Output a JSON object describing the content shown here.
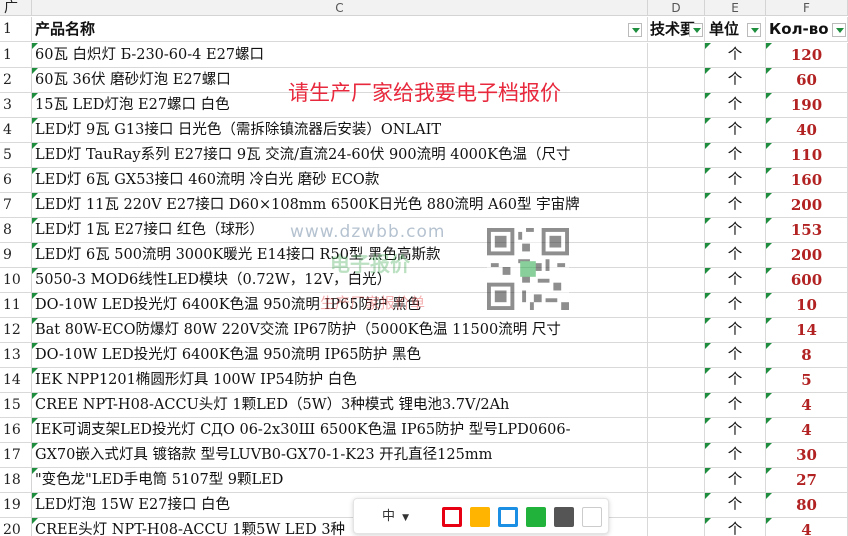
{
  "column_headers": [
    "广",
    "C",
    "D",
    "E",
    "F"
  ],
  "table_header": {
    "row_label": "1",
    "name": "产品名称",
    "tech": "技术要",
    "unit": "单位",
    "qty": "Кол-во"
  },
  "rows": [
    {
      "n": "1",
      "name": "60瓦 白炽灯 Б-230-60-4 E27螺口",
      "unit": "个",
      "qty": "120"
    },
    {
      "n": "2",
      "name": "60瓦 36伏 磨砂灯泡 E27螺口",
      "unit": "个",
      "qty": "60"
    },
    {
      "n": "3",
      "name": "15瓦 LED灯泡 E27螺口 白色",
      "unit": "个",
      "qty": "190"
    },
    {
      "n": "4",
      "name": "LED灯 9瓦 G13接口 日光色（需拆除镇流器后安装）ONLAIT",
      "unit": "个",
      "qty": "40"
    },
    {
      "n": "5",
      "name": "LED灯 TauRay系列 E27接口 9瓦 交流/直流24-60伏 900流明 4000K色温（尺寸",
      "unit": "个",
      "qty": "110"
    },
    {
      "n": "6",
      "name": "LED灯 6瓦 GX53接口 460流明 冷白光 磨砂 ECO款",
      "unit": "个",
      "qty": "160"
    },
    {
      "n": "7",
      "name": "LED灯 11瓦 220V E27接口 D60×108mm 6500K日光色 880流明 A60型 宇宙牌",
      "unit": "个",
      "qty": "200"
    },
    {
      "n": "8",
      "name": "LED灯 1瓦 E27接口 红色（球形）",
      "unit": "个",
      "qty": "153"
    },
    {
      "n": "9",
      "name": "LED灯 6瓦 500流明 3000K暖光 E14接口 R50型 黑色高斯款",
      "unit": "个",
      "qty": "200"
    },
    {
      "n": "10",
      "name": "5050-3 MOD6线性LED模块（0.72W，12V，白光）",
      "unit": "个",
      "qty": "600"
    },
    {
      "n": "11",
      "name": "DO-10W LED投光灯 6400K色温 950流明 IP65防护 黑色",
      "unit": "个",
      "qty": "10"
    },
    {
      "n": "12",
      "name": "Bat 80W-ECO防爆灯 80W 220V交流 IP67防护（5000K色温 11500流明 尺寸",
      "unit": "个",
      "qty": "14"
    },
    {
      "n": "13",
      "name": " DO-10W LED投光灯 6400K色温 950流明 IP65防护 黑色",
      "unit": "个",
      "qty": "8"
    },
    {
      "n": "14",
      "name": " IEK NPP1201椭圆形灯具 100W IP54防护 白色",
      "unit": "个",
      "qty": "5"
    },
    {
      "n": "15",
      "name": "CREE NPT-H08-ACCU头灯 1颗LED（5W）3种模式 锂电池3.7V/2Ah",
      "unit": "个",
      "qty": "4"
    },
    {
      "n": "16",
      "name": "IEK可调支架LED投光灯 СДО 06-2x30Ш 6500K色温 IP65防护 型号LPD0606-",
      "unit": "个",
      "qty": "4"
    },
    {
      "n": "17",
      "name": "GX70嵌入式灯具 镀铬款 型号LUVB0-GX70-1-K23 开孔直径125mm",
      "unit": "个",
      "qty": "30"
    },
    {
      "n": "18",
      "name": "\"变色龙\"LED手电筒 5107型 9颗LED",
      "unit": "个",
      "qty": "27"
    },
    {
      "n": "19",
      "name": "LED灯泡 15W E27接口 白色",
      "unit": "个",
      "qty": "80"
    },
    {
      "n": "20",
      "name": "CREE头灯 NPT-H08-ACCU 1颗5W LED 3种",
      "unit": "个",
      "qty": "4"
    }
  ],
  "overlay_note": "请生产厂家给我要电子档报价",
  "watermark": {
    "url": "www.dzwbb.com",
    "logo": "电子报价",
    "sub": "生产厂家报价单"
  },
  "toolbar": {
    "font_size_value": "中",
    "swatch_colors": [
      "#e60012",
      "#ffb400",
      "#1a8fe3",
      "#20b23a",
      "#555555",
      "#ffffff"
    ]
  },
  "colors": {
    "qty_text": "#b22222",
    "marker_green": "#1e8e3e",
    "note_red": "#e8283c"
  }
}
